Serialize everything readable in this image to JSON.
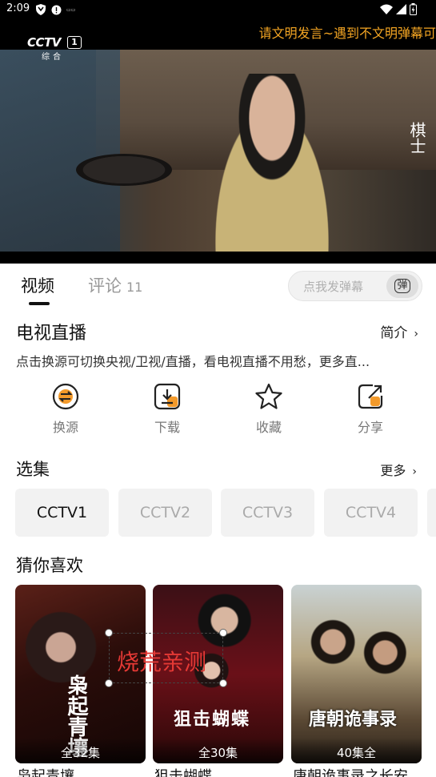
{
  "status_bar": {
    "time": "2:09",
    "left_icons": [
      "shield-icon",
      "alert-icon",
      "app-icon"
    ],
    "right_icons": [
      "wifi-icon",
      "signal-icon",
      "battery-icon"
    ]
  },
  "player": {
    "channel_logo_text": "CCTV",
    "channel_logo_number": "1",
    "channel_logo_sub": "综合",
    "danmaku_notice": "请文明发言~遇到不文明弹幕可",
    "corner_glyph": "棋士"
  },
  "tabs": {
    "video": "视频",
    "comments": "评论",
    "comment_count": "11",
    "danmaku_placeholder": "点我发弹幕",
    "danmaku_button": "弹"
  },
  "info": {
    "title": "电视直播",
    "intro_link": "简介",
    "description": "点击换源可切换央视/卫视/直播，看电视直播不用愁，更多直..."
  },
  "actions": [
    {
      "label": "换源",
      "icon": "switch-source-icon"
    },
    {
      "label": "下载",
      "icon": "download-icon"
    },
    {
      "label": "收藏",
      "icon": "star-icon"
    },
    {
      "label": "分享",
      "icon": "share-icon"
    }
  ],
  "episodes": {
    "title": "选集",
    "more": "更多",
    "items": [
      "CCTV1",
      "CCTV2",
      "CCTV3",
      "CCTV4"
    ],
    "selected": "CCTV1"
  },
  "recommend": {
    "title": "猜你喜欢",
    "items": [
      {
        "title": "枭起青壤",
        "badge": "全32集",
        "poster_text": "枭起青壤"
      },
      {
        "title": "狙击蝴蝶",
        "badge": "全30集",
        "poster_text": "狙击蝴蝶"
      },
      {
        "title": "唐朝诡事录之长安",
        "badge": "40集全",
        "poster_text": "唐朝诡事录"
      }
    ]
  },
  "overlay": {
    "text": "烧荒亲测"
  },
  "colors": {
    "accent_orange": "#f39a2b",
    "notice_orange": "#f5a623",
    "overlay_red": "#e53935"
  }
}
